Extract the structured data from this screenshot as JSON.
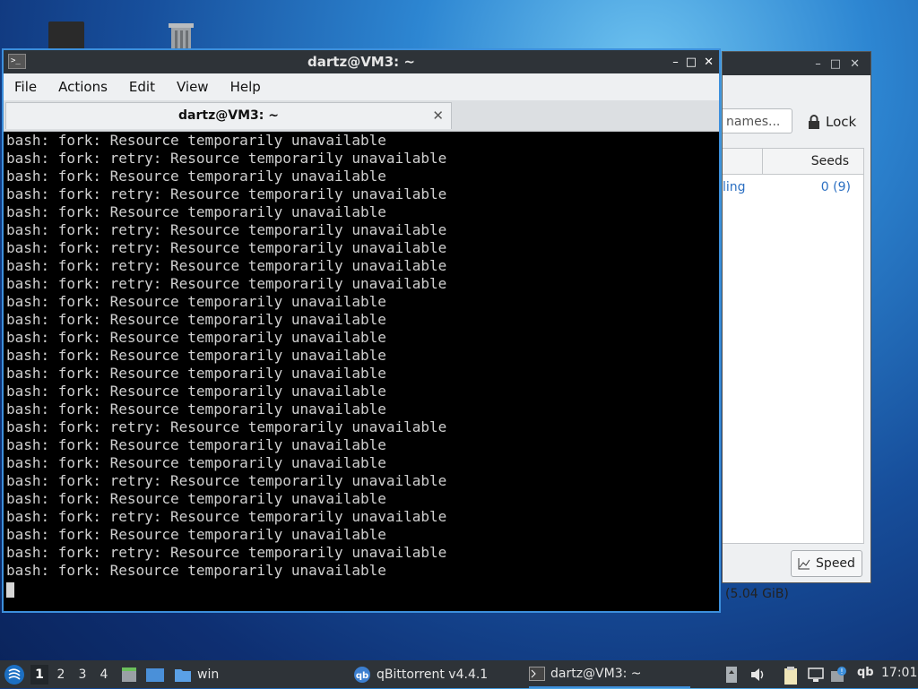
{
  "desktop": {
    "icons": [
      "monitor-icon",
      "trash-icon"
    ]
  },
  "qbittorrent_window": {
    "search_placeholder": "names...",
    "lock_label": "Lock",
    "column_seeds": "Seeds",
    "row_status": "ling",
    "row_seeds": "0 (9)",
    "speed_button": "Speed",
    "status_text": "(5.04 GiB)"
  },
  "terminal": {
    "title": "dartz@VM3: ~",
    "menu": [
      "File",
      "Actions",
      "Edit",
      "View",
      "Help"
    ],
    "tab_label": "dartz@VM3: ~",
    "lines": [
      "bash: fork: Resource temporarily unavailable",
      "bash: fork: retry: Resource temporarily unavailable",
      "bash: fork: Resource temporarily unavailable",
      "bash: fork: retry: Resource temporarily unavailable",
      "bash: fork: Resource temporarily unavailable",
      "bash: fork: retry: Resource temporarily unavailable",
      "bash: fork: retry: Resource temporarily unavailable",
      "bash: fork: retry: Resource temporarily unavailable",
      "bash: fork: retry: Resource temporarily unavailable",
      "bash: fork: Resource temporarily unavailable",
      "bash: fork: Resource temporarily unavailable",
      "bash: fork: Resource temporarily unavailable",
      "bash: fork: Resource temporarily unavailable",
      "bash: fork: Resource temporarily unavailable",
      "bash: fork: Resource temporarily unavailable",
      "bash: fork: Resource temporarily unavailable",
      "bash: fork: retry: Resource temporarily unavailable",
      "bash: fork: Resource temporarily unavailable",
      "bash: fork: Resource temporarily unavailable",
      "bash: fork: retry: Resource temporarily unavailable",
      "bash: fork: Resource temporarily unavailable",
      "bash: fork: retry: Resource temporarily unavailable",
      "bash: fork: Resource temporarily unavailable",
      "bash: fork: retry: Resource temporarily unavailable",
      "bash: fork: Resource temporarily unavailable"
    ]
  },
  "taskbar": {
    "workspaces": [
      "1",
      "2",
      "3",
      "4"
    ],
    "active_workspace": "1",
    "tasks": {
      "win_folder": "win",
      "qbittorrent": "qBittorrent v4.4.1",
      "terminal": "dartz@VM3: ~"
    },
    "clock": "17:01",
    "tray_qb": "qb",
    "accent_color": "#3c8fdc"
  }
}
